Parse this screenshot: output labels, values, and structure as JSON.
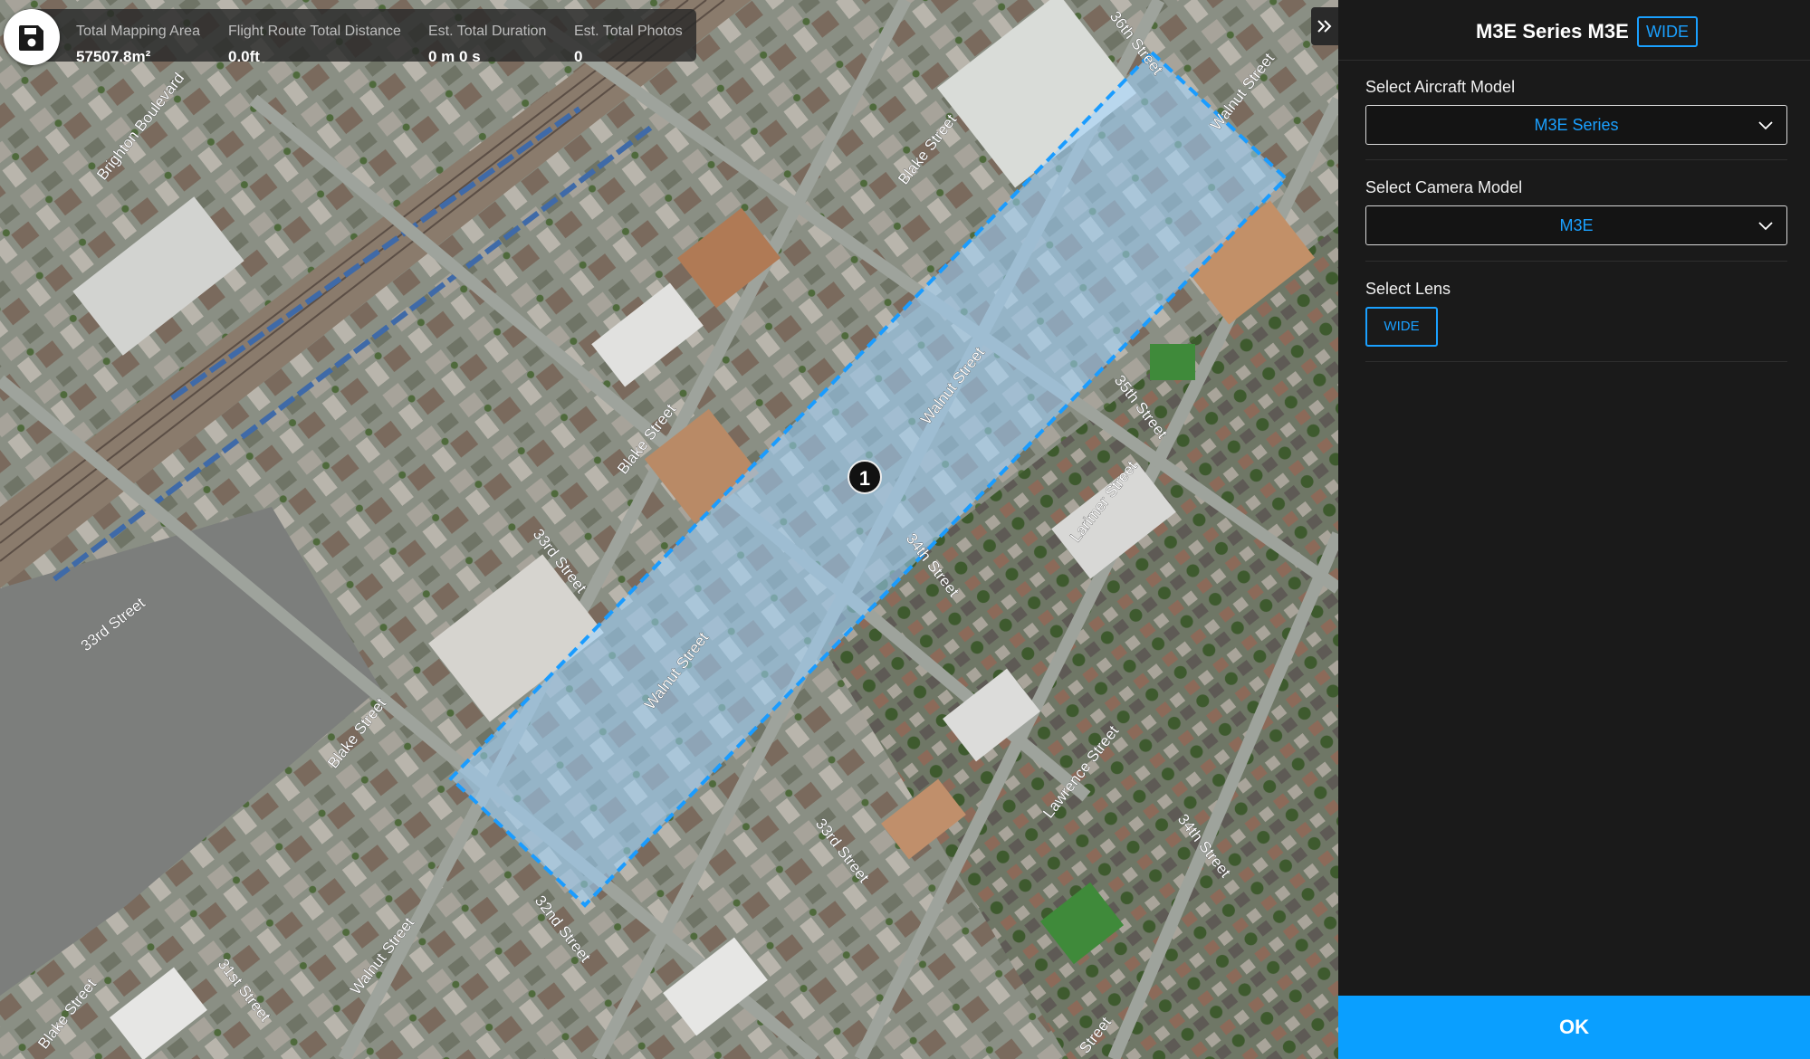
{
  "stats": {
    "items": [
      {
        "label": "Total Mapping Area",
        "value": "57507.8m²"
      },
      {
        "label": "Flight Route Total Distance",
        "value": "0.0ft"
      },
      {
        "label": "Est. Total Duration",
        "value": "0 m 0 s"
      },
      {
        "label": "Est. Total Photos",
        "value": "0"
      }
    ]
  },
  "map": {
    "waypoint_label": "1",
    "street_labels": [
      "36th Street",
      "Walnut Street",
      "Blake Street",
      "35th Street",
      "Brighton Boulevard",
      "Walnut Street",
      "Blake Street",
      "34th Street",
      "Larimer Street",
      "33rd Street",
      "33rd Street",
      "Walnut Street",
      "Blake Street",
      "Lawrence Street",
      "34th Street",
      "32nd Street",
      "33rd Street",
      "31st Street",
      "Walnut Street",
      "Blake Street",
      "Street"
    ],
    "colors": {
      "area_fill": "#9fd3ff",
      "area_border": "#1a9cff"
    }
  },
  "panel": {
    "title": "M3E Series M3E",
    "badge": "WIDE",
    "aircraft_label": "Select Aircraft Model",
    "aircraft_value": "M3E Series",
    "camera_label": "Select Camera Model",
    "camera_value": "M3E",
    "lens_label": "Select Lens",
    "lens_option": "WIDE",
    "ok_label": "OK"
  },
  "icons": {
    "save": "save-icon",
    "collapse": "double-chevron-right-icon",
    "chevron": "chevron-down-icon"
  }
}
